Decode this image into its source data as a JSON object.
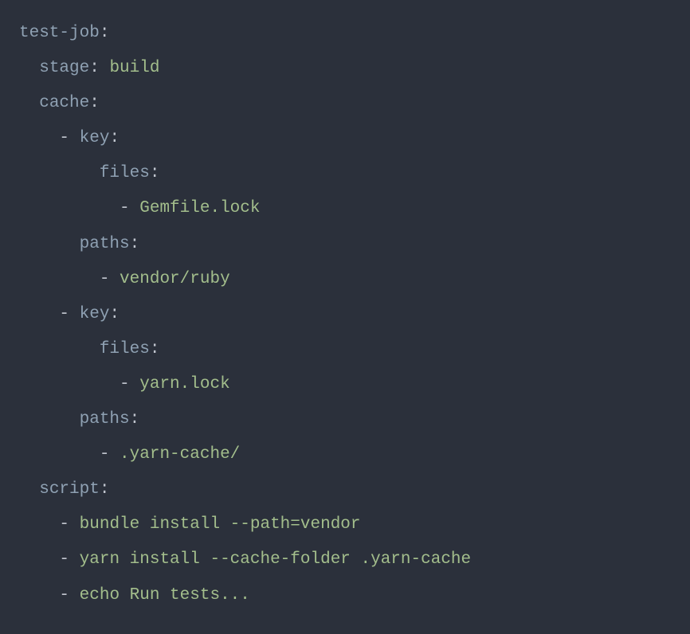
{
  "code": {
    "job_name": "test-job",
    "stage_key": "stage",
    "stage_value": "build",
    "cache_key": "cache",
    "key_key": "key",
    "files_key": "files",
    "paths_key": "paths",
    "script_key": "script",
    "cache": [
      {
        "files": [
          "Gemfile.lock"
        ],
        "paths": [
          "vendor/ruby"
        ]
      },
      {
        "files": [
          "yarn.lock"
        ],
        "paths": [
          ".yarn-cache/"
        ]
      }
    ],
    "script": [
      "bundle install --path=vendor",
      "yarn install --cache-folder .yarn-cache",
      "echo Run tests..."
    ]
  }
}
